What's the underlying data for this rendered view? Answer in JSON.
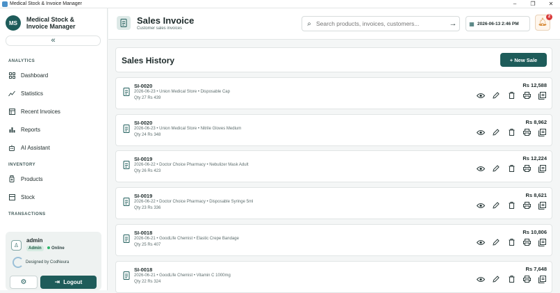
{
  "window": {
    "title": "Medical Stock & Invoice Manager",
    "controls": [
      "–",
      "❐",
      "✕"
    ]
  },
  "sidebar": {
    "avatar_initials": "MS",
    "brand": "Medical Stock & Invoice Manager",
    "collapse_label": "«",
    "sections": {
      "analytics": "ANALYTICS",
      "inventory": "INVENTORY",
      "transactions": "TRANSACTIONS"
    },
    "items": [
      {
        "label": "Dashboard",
        "icon": "dashboard-icon"
      },
      {
        "label": "Statistics",
        "icon": "statistics-icon"
      },
      {
        "label": "Recent Invoices",
        "icon": "invoices-icon"
      },
      {
        "label": "Reports",
        "icon": "reports-icon"
      },
      {
        "label": "AI Assistant",
        "icon": "robot-icon"
      },
      {
        "label": "Products",
        "icon": "products-icon"
      },
      {
        "label": "Stock",
        "icon": "stock-icon"
      }
    ],
    "user": {
      "name": "admin",
      "role": "Admin",
      "status": "Online"
    },
    "designed_by": "Designed by CodNeura",
    "logout_label": "Logout"
  },
  "header": {
    "title": "Sales Invoice",
    "subtitle": "Customer sales invoices",
    "search_placeholder": "Search products, invoices, customers...",
    "datetime": "2026-06-13  2:46 PM",
    "notification_count": "2"
  },
  "main": {
    "panel_title": "Sales History",
    "new_sale_label": "+ New Sale",
    "rows": [
      {
        "id": "SI-0020",
        "meta": "2026-06-23 • Union Medical Store • Disposable Cap",
        "qty": "Qty 27 Rs 439",
        "amount": "Rs 12,588"
      },
      {
        "id": "SI-0020",
        "meta": "2026-06-23 • Union Medical Store • Nitrile Gloves Medium",
        "qty": "Qty 24 Rs 348",
        "amount": "Rs 8,962"
      },
      {
        "id": "SI-0019",
        "meta": "2026-06-22 • Doctor Choice Pharmacy • Nebulizer Mask Adult",
        "qty": "Qty 26 Rs 423",
        "amount": "Rs 12,224"
      },
      {
        "id": "SI-0019",
        "meta": "2026-06-22 • Doctor Choice Pharmacy • Disposable Syringe 5ml",
        "qty": "Qty 23 Rs 336",
        "amount": "Rs 8,621"
      },
      {
        "id": "SI-0018",
        "meta": "2026-06-21 • GoodLife Chemist • Elastic Crepe Bandage",
        "qty": "Qty 25 Rs 407",
        "amount": "Rs 10,806"
      },
      {
        "id": "SI-0018",
        "meta": "2026-06-21 • GoodLife Chemist • Vitamin C 1000mg",
        "qty": "Qty 22 Rs 324",
        "amount": "Rs 7,648"
      }
    ]
  },
  "colors": {
    "brand": "#1e5c5a",
    "notification": "#d83a3a",
    "online": "#2db56a"
  }
}
